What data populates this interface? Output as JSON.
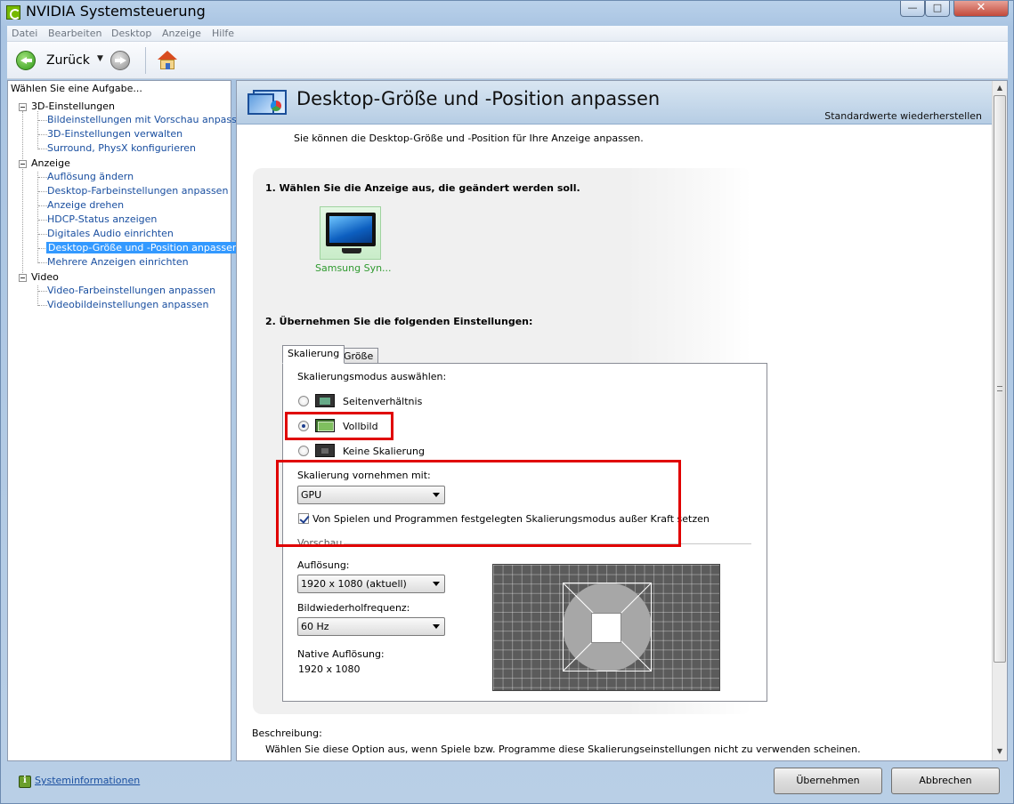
{
  "window": {
    "title": "NVIDIA Systemsteuerung",
    "min_glyph": "—",
    "max_glyph": "□",
    "close_glyph": "✕"
  },
  "menu": [
    "Datei",
    "Bearbeiten",
    "Desktop",
    "Anzeige",
    "Hilfe"
  ],
  "toolbar": {
    "back_label": "Zurück",
    "back_dropdown_glyph": "▼"
  },
  "sidebar": {
    "header": "Wählen Sie eine Aufgabe...",
    "categories": [
      {
        "label": "3D-Einstellungen",
        "items": [
          "Bildeinstellungen mit Vorschau anpassen",
          "3D-Einstellungen verwalten",
          "Surround, PhysX konfigurieren"
        ]
      },
      {
        "label": "Anzeige",
        "items": [
          "Auflösung ändern",
          "Desktop-Farbeinstellungen anpassen",
          "Anzeige drehen",
          "HDCP-Status anzeigen",
          "Digitales Audio einrichten",
          "Desktop-Größe und -Position anpassen",
          "Mehrere Anzeigen einrichten"
        ]
      },
      {
        "label": "Video",
        "items": [
          "Video-Farbeinstellungen anpassen",
          "Videobildeinstellungen anpassen"
        ]
      }
    ],
    "selected": "Desktop-Größe und -Position anpassen"
  },
  "main": {
    "title": "Desktop-Größe und -Position anpassen",
    "restore_label": "Standardwerte wiederherstellen",
    "intro": "Sie können die Desktop-Größe und -Position für Ihre Anzeige anpassen.",
    "step1": "1. Wählen Sie die Anzeige aus, die geändert werden soll.",
    "monitor_label": "Samsung Syn...",
    "step2": "2. Übernehmen Sie die folgenden Einstellungen:",
    "tabs": [
      {
        "label": "Skalierung",
        "active": true
      },
      {
        "label": "Größe",
        "active": false
      }
    ],
    "scaling_mode_label": "Skalierungsmodus auswählen:",
    "modes": [
      {
        "label": "Seitenverhältnis",
        "checked": false
      },
      {
        "label": "Vollbild",
        "checked": true
      },
      {
        "label": "Keine Skalierung",
        "checked": false
      }
    ],
    "perform_with_label": "Skalierung vornehmen mit:",
    "perform_with_value": "GPU",
    "override_label": "Von Spielen und Programmen festgelegten Skalierungsmodus außer Kraft setzen",
    "override_checked": true,
    "preview_label": "Vorschau",
    "resolution_label": "Auflösung:",
    "resolution_value": "1920 x 1080 (aktuell)",
    "refresh_label": "Bildwiederholfrequenz:",
    "refresh_value": "60 Hz",
    "native_label": "Native Auflösung:",
    "native_value": "1920 x 1080",
    "description_title": "Beschreibung:",
    "description_text": "Wählen Sie diese Option aus, wenn Spiele bzw. Programme diese Skalierungseinstellungen nicht zu verwenden scheinen."
  },
  "footer": {
    "sysinfo_label": "Systeminformationen",
    "apply_label": "Übernehmen",
    "cancel_label": "Abbrechen"
  },
  "colors": {
    "highlight": "#e00000",
    "link": "#1a4fa0",
    "selected_bg": "#3399ff"
  }
}
